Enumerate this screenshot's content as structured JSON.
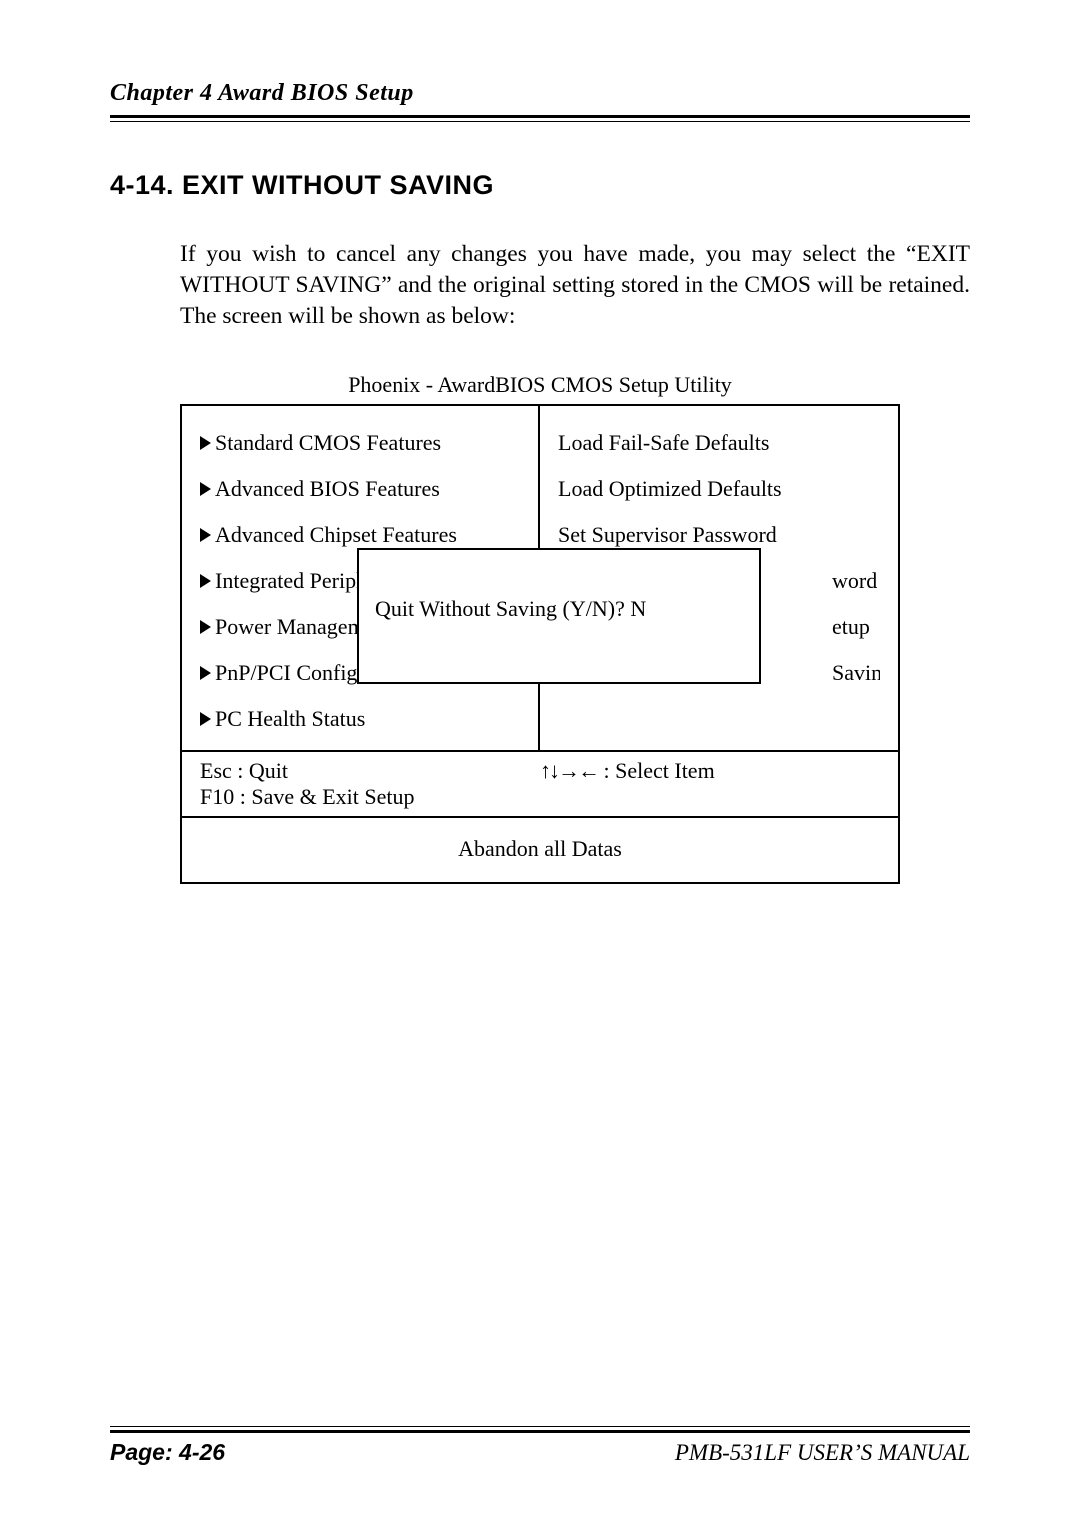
{
  "header": {
    "chapter": "Chapter    4   Award BIOS Setup"
  },
  "section": {
    "title": "4-14. EXIT WITHOUT SAVING",
    "body": "If you wish to cancel any changes you have made, you may select the “EXIT WITHOUT SAVING” and the original setting stored in the CMOS will be retained. The screen will be shown as below:"
  },
  "bios": {
    "caption": "Phoenix - AwardBIOS CMOS Setup Utility",
    "left_items": [
      "Standard CMOS Features",
      "Advanced BIOS Features",
      "Advanced Chipset Features",
      "Integrated Periphera",
      "Power Management",
      "PnP/PCI Configura",
      "PC Health Status"
    ],
    "right_items": [
      "Load Fail-Safe Defaults",
      "Load Optimized Defaults",
      "Set Supervisor Password"
    ],
    "right_fragments": [
      "word",
      "etup",
      "Saving"
    ],
    "dialog": "Quit Without Saving (Y/N)? N",
    "nav": {
      "esc": "Esc : Quit",
      "f10": "F10 : Save & Exit Setup",
      "arrows": "↑↓→←",
      "select": " : Select Item"
    },
    "footer": "Abandon all Datas"
  },
  "page_footer": {
    "page": "Page: 4-26",
    "manual": "PMB-531LF USER’S MANUAL"
  }
}
